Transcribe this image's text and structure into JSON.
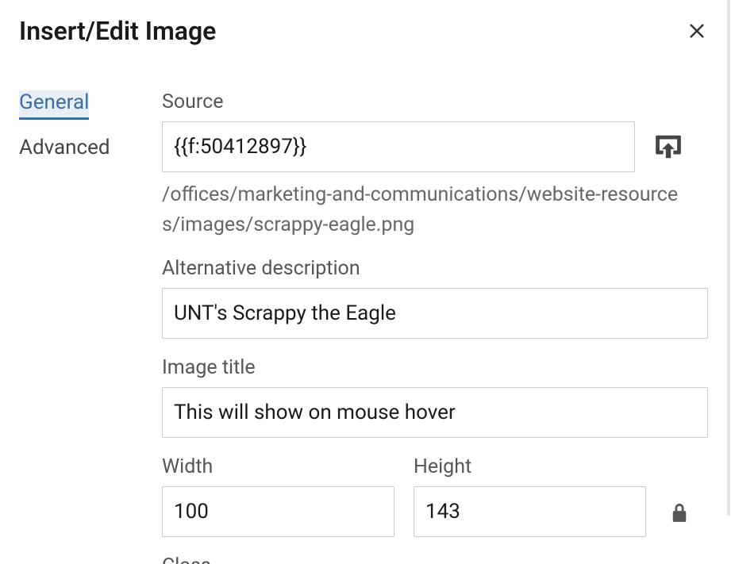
{
  "dialog": {
    "title": "Insert/Edit Image"
  },
  "tabs": {
    "general": "General",
    "advanced": "Advanced"
  },
  "fields": {
    "source_label": "Source",
    "source_value": "{{f:50412897}}",
    "source_path": "/offices/marketing-and-communications/website-resources/images/scrappy-eagle.png",
    "alt_label": "Alternative description",
    "alt_value": "UNT's Scrappy the Eagle",
    "title_label": "Image title",
    "title_value": "This will show on mouse hover",
    "width_label": "Width",
    "width_value": "100",
    "height_label": "Height",
    "height_value": "143",
    "cutoff_label": "Class"
  }
}
